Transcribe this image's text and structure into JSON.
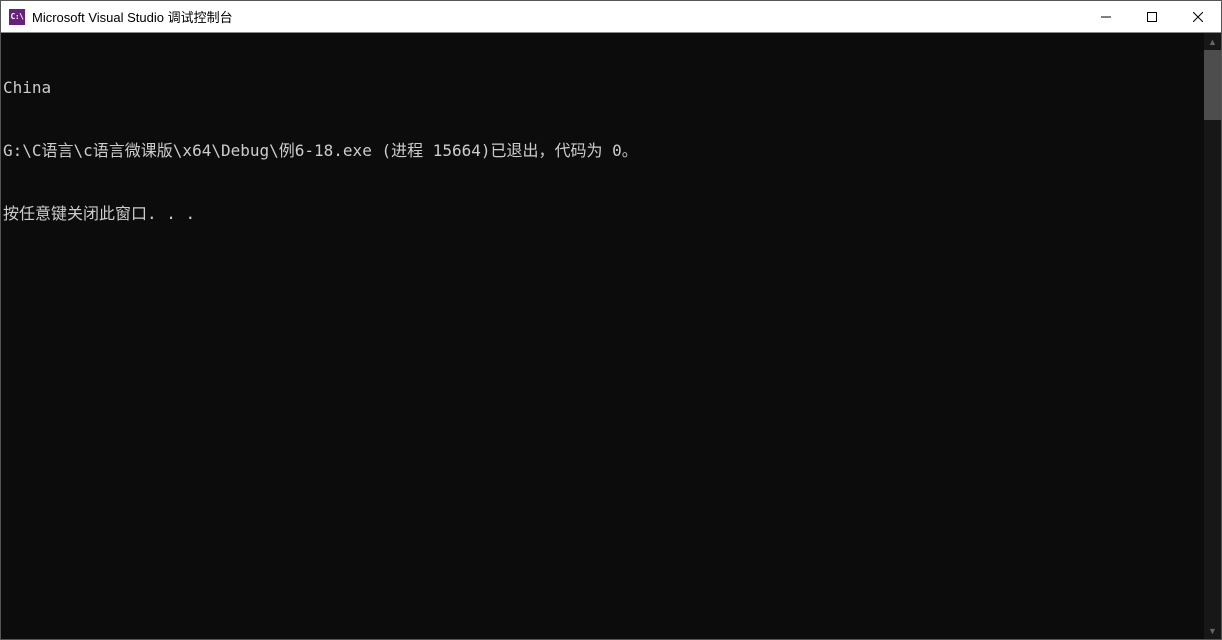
{
  "window": {
    "icon_text": "C:\\",
    "title": "Microsoft Visual Studio 调试控制台"
  },
  "console": {
    "lines": [
      "China",
      "G:\\C语言\\c语言微课版\\x64\\Debug\\例6-18.exe (进程 15664)已退出，代码为 0。",
      "按任意键关闭此窗口. . ."
    ]
  }
}
